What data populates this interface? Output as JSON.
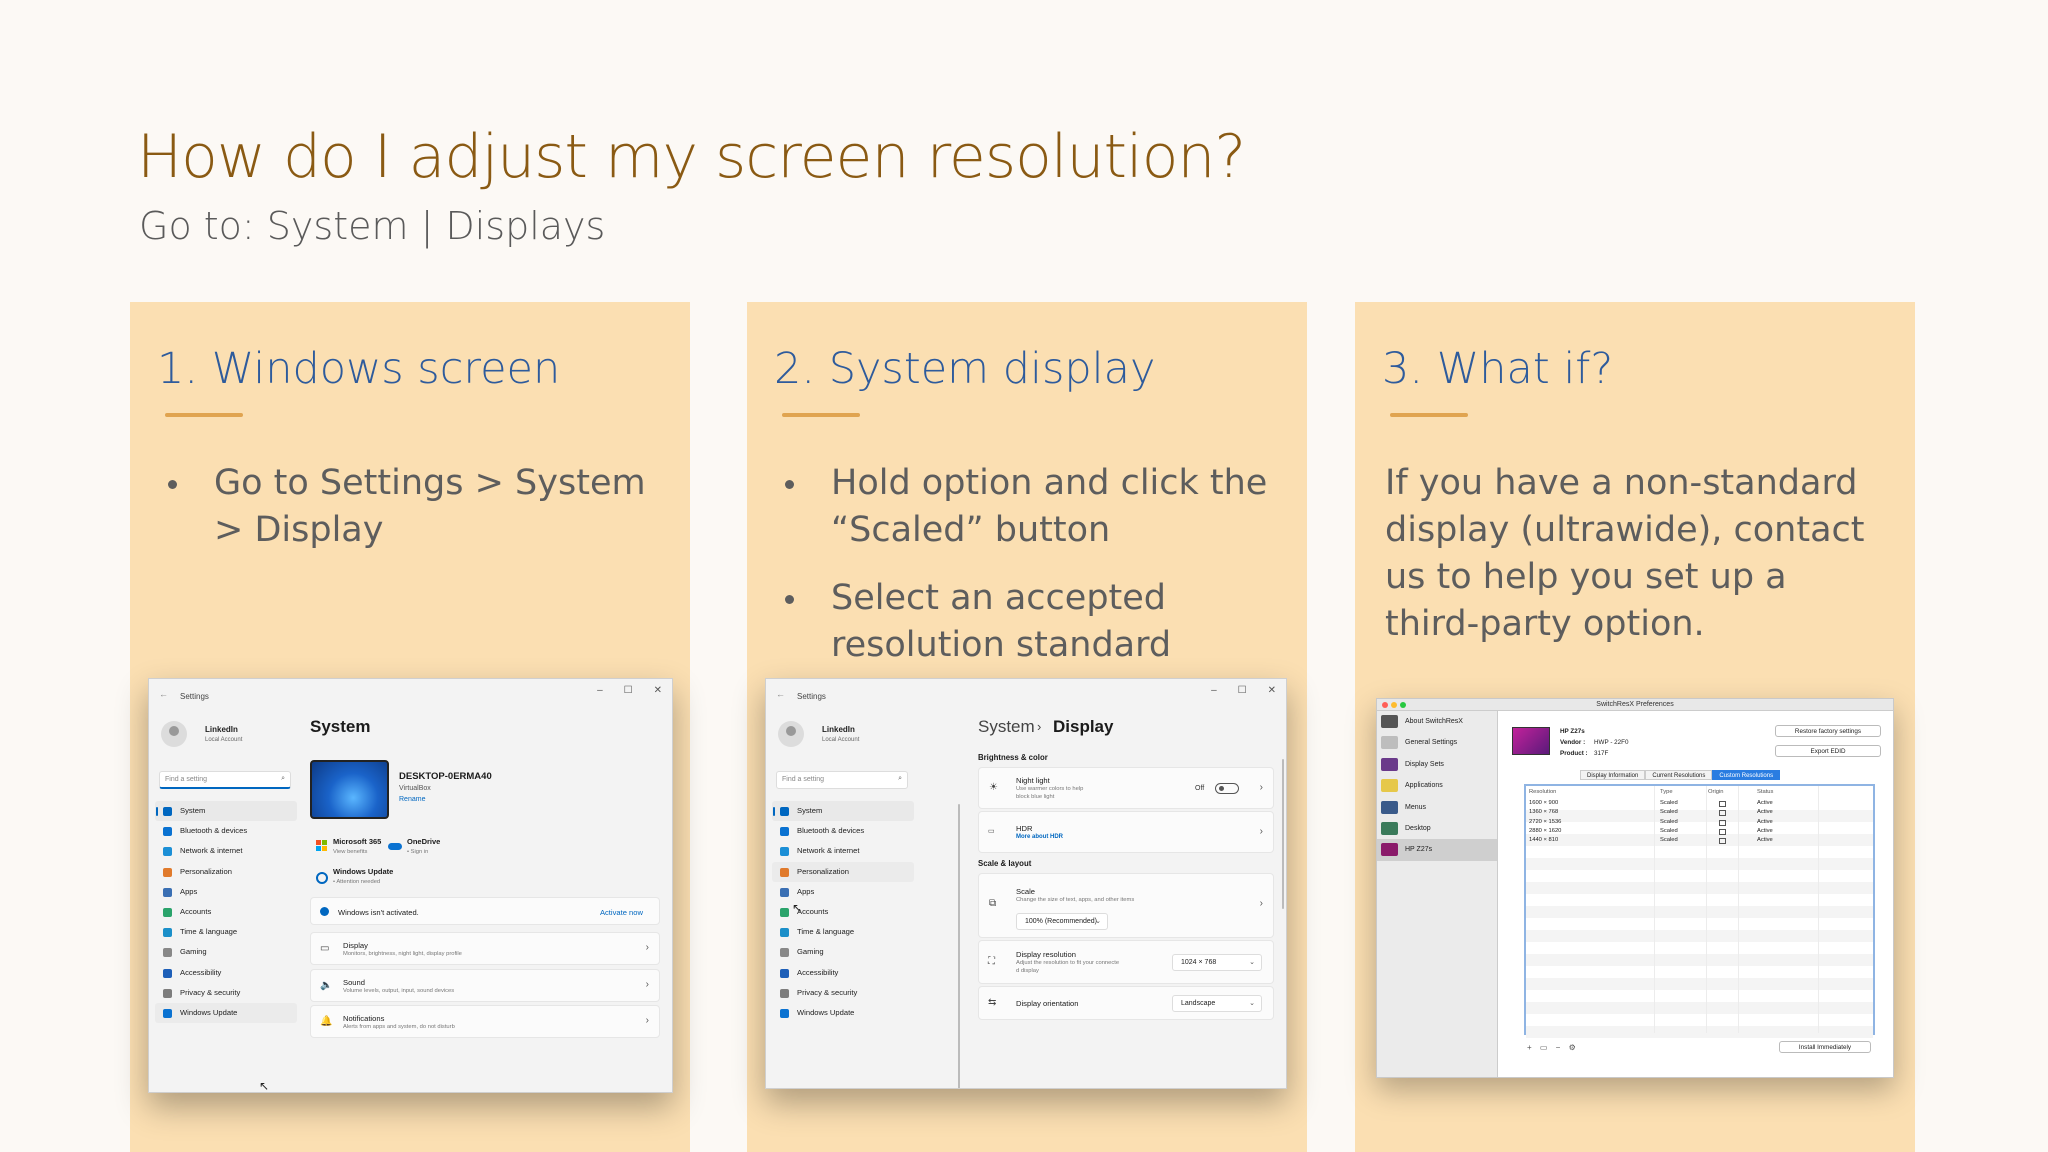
{
  "slide": {
    "title": "How do I adjust my screen resolution?",
    "subtitle": "Go to: System  | Displays",
    "accent_color": "#8a5a13",
    "panel_color": "#fbdfb2",
    "heading_color": "#2e5b9c"
  },
  "columns": [
    {
      "title": "1. Windows screen",
      "bullets": [
        "Go to Settings > System > Display"
      ]
    },
    {
      "title": "2. System display",
      "bullets": [
        "Hold option and click the “Scaled” button",
        "Select an accepted resolution standard"
      ]
    },
    {
      "title": "3. What if?",
      "paragraph": "If you have a non-standard display (ultrawide), contact us to help you set up a third-party option."
    }
  ],
  "win1": {
    "app_title": "Settings",
    "user_name": "LinkedIn",
    "user_sub": "Local Account",
    "search_placeholder": "Find a setting",
    "nav": [
      {
        "label": "System",
        "icon": "system-icon",
        "color": "#0067c0"
      },
      {
        "label": "Bluetooth & devices",
        "icon": "bluetooth-icon",
        "color": "#0a72d1"
      },
      {
        "label": "Network & internet",
        "icon": "network-icon",
        "color": "#1c8fd6"
      },
      {
        "label": "Personalization",
        "icon": "brush-icon",
        "color": "#e07a2c"
      },
      {
        "label": "Apps",
        "icon": "apps-icon",
        "color": "#3a6fb3"
      },
      {
        "label": "Accounts",
        "icon": "accounts-icon",
        "color": "#2aa36b"
      },
      {
        "label": "Time & language",
        "icon": "globe-icon",
        "color": "#1b8fc9"
      },
      {
        "label": "Gaming",
        "icon": "gaming-icon",
        "color": "#888888"
      },
      {
        "label": "Accessibility",
        "icon": "accessibility-icon",
        "color": "#1d5fb8"
      },
      {
        "label": "Privacy & security",
        "icon": "shield-icon",
        "color": "#7d7d7d"
      },
      {
        "label": "Windows Update",
        "icon": "update-icon",
        "color": "#0a72d1"
      }
    ],
    "page_title": "System",
    "device_name": "DESKTOP-0ERMA40",
    "device_sub": "VirtualBox",
    "rename": "Rename",
    "ms365": "Microsoft 365",
    "ms365_sub": "View benefits",
    "onedrive": "OneDrive",
    "onedrive_sub": "• Sign in",
    "wu": "Windows Update",
    "wu_sub": "• Attention needed",
    "activation": "Windows isn't activated.",
    "activate_now": "Activate now",
    "cards": [
      {
        "title": "Display",
        "sub": "Monitors, brightness, night light, display profile",
        "icon": "monitor-icon"
      },
      {
        "title": "Sound",
        "sub": "Volume levels, output, input, sound devices",
        "icon": "speaker-icon"
      },
      {
        "title": "Notifications",
        "sub": "Alerts from apps and system, do not disturb",
        "icon": "bell-icon"
      }
    ]
  },
  "win2": {
    "app_title": "Settings",
    "user_name": "LinkedIn",
    "user_sub": "Local Account",
    "search_placeholder": "Find a setting",
    "nav": [
      {
        "label": "System",
        "icon": "system-icon",
        "color": "#0067c0"
      },
      {
        "label": "Bluetooth & devices",
        "icon": "bluetooth-icon",
        "color": "#0a72d1"
      },
      {
        "label": "Network & internet",
        "icon": "network-icon",
        "color": "#1c8fd6"
      },
      {
        "label": "Personalization",
        "icon": "brush-icon",
        "color": "#e07a2c"
      },
      {
        "label": "Apps",
        "icon": "apps-icon",
        "color": "#3a6fb3"
      },
      {
        "label": "Accounts",
        "icon": "accounts-icon",
        "color": "#2aa36b"
      },
      {
        "label": "Time & language",
        "icon": "globe-icon",
        "color": "#1b8fc9"
      },
      {
        "label": "Gaming",
        "icon": "gaming-icon",
        "color": "#888888"
      },
      {
        "label": "Accessibility",
        "icon": "accessibility-icon",
        "color": "#1d5fb8"
      },
      {
        "label": "Privacy & security",
        "icon": "shield-icon",
        "color": "#7d7d7d"
      },
      {
        "label": "Windows Update",
        "icon": "update-icon",
        "color": "#0a72d1"
      }
    ],
    "breadcrumb_parent": "System",
    "breadcrumb_sep": "›",
    "breadcrumb_current": "Display",
    "brightness_heading": "Brightness & color",
    "night_light": "Night light",
    "night_light_sub": "Use warmer colors to help",
    "night_light_sub2": "block blue light",
    "night_light_state": "Off",
    "hdr": "HDR",
    "hdr_link": "More about HDR",
    "scale_heading": "Scale & layout",
    "scale": "Scale",
    "scale_sub": "Change the size of text, apps, and other items",
    "scale_value": "100% (Recommended)",
    "resolution": "Display resolution",
    "resolution_sub": "Adjust the resolution to fit your connecte",
    "resolution_sub2": "d display",
    "resolution_value": "1024 × 768",
    "orientation": "Display orientation",
    "orientation_value": "Landscape"
  },
  "mac": {
    "title": "SwitchResX Preferences",
    "sidebar": [
      {
        "label": "About SwitchResX",
        "icon": "about-icon",
        "color": "#555555"
      },
      {
        "label": "General Settings",
        "icon": "settings-icon",
        "color": "#bdbdbd"
      },
      {
        "label": "Display Sets",
        "icon": "display-sets-icon",
        "color": "#6a3a8a"
      },
      {
        "label": "Applications",
        "icon": "applications-icon",
        "color": "#e6c84a"
      },
      {
        "label": "Menus",
        "icon": "menus-icon",
        "color": "#3a5a8a"
      },
      {
        "label": "Desktop",
        "icon": "desktop-icon",
        "color": "#3a7a5a"
      },
      {
        "label": "HP Z27s",
        "icon": "monitor-icon",
        "color": "#8a1a6a"
      }
    ],
    "device": "HP Z27s",
    "vendor_label": "Vendor :",
    "vendor": "HWP - 22F0",
    "product_label": "Product :",
    "product": "317F",
    "restore_btn": "Restore factory settings",
    "export_btn": "Export EDID",
    "tabs": [
      "Display Information",
      "Current Resolutions",
      "Custom Resolutions"
    ],
    "headers": [
      "Resolution",
      "Type",
      "Origin",
      "Status"
    ],
    "rows": [
      [
        "1600 × 900",
        "Scaled",
        "Active"
      ],
      [
        "1360 × 768",
        "Scaled",
        "Active"
      ],
      [
        "2720 × 1536",
        "Scaled",
        "Active"
      ],
      [
        "2880 × 1620",
        "Scaled",
        "Active"
      ],
      [
        "1440 × 810",
        "Scaled",
        "Active"
      ]
    ],
    "tools": "+ ▭ − ⚙",
    "install_btn": "Install Immediately"
  }
}
